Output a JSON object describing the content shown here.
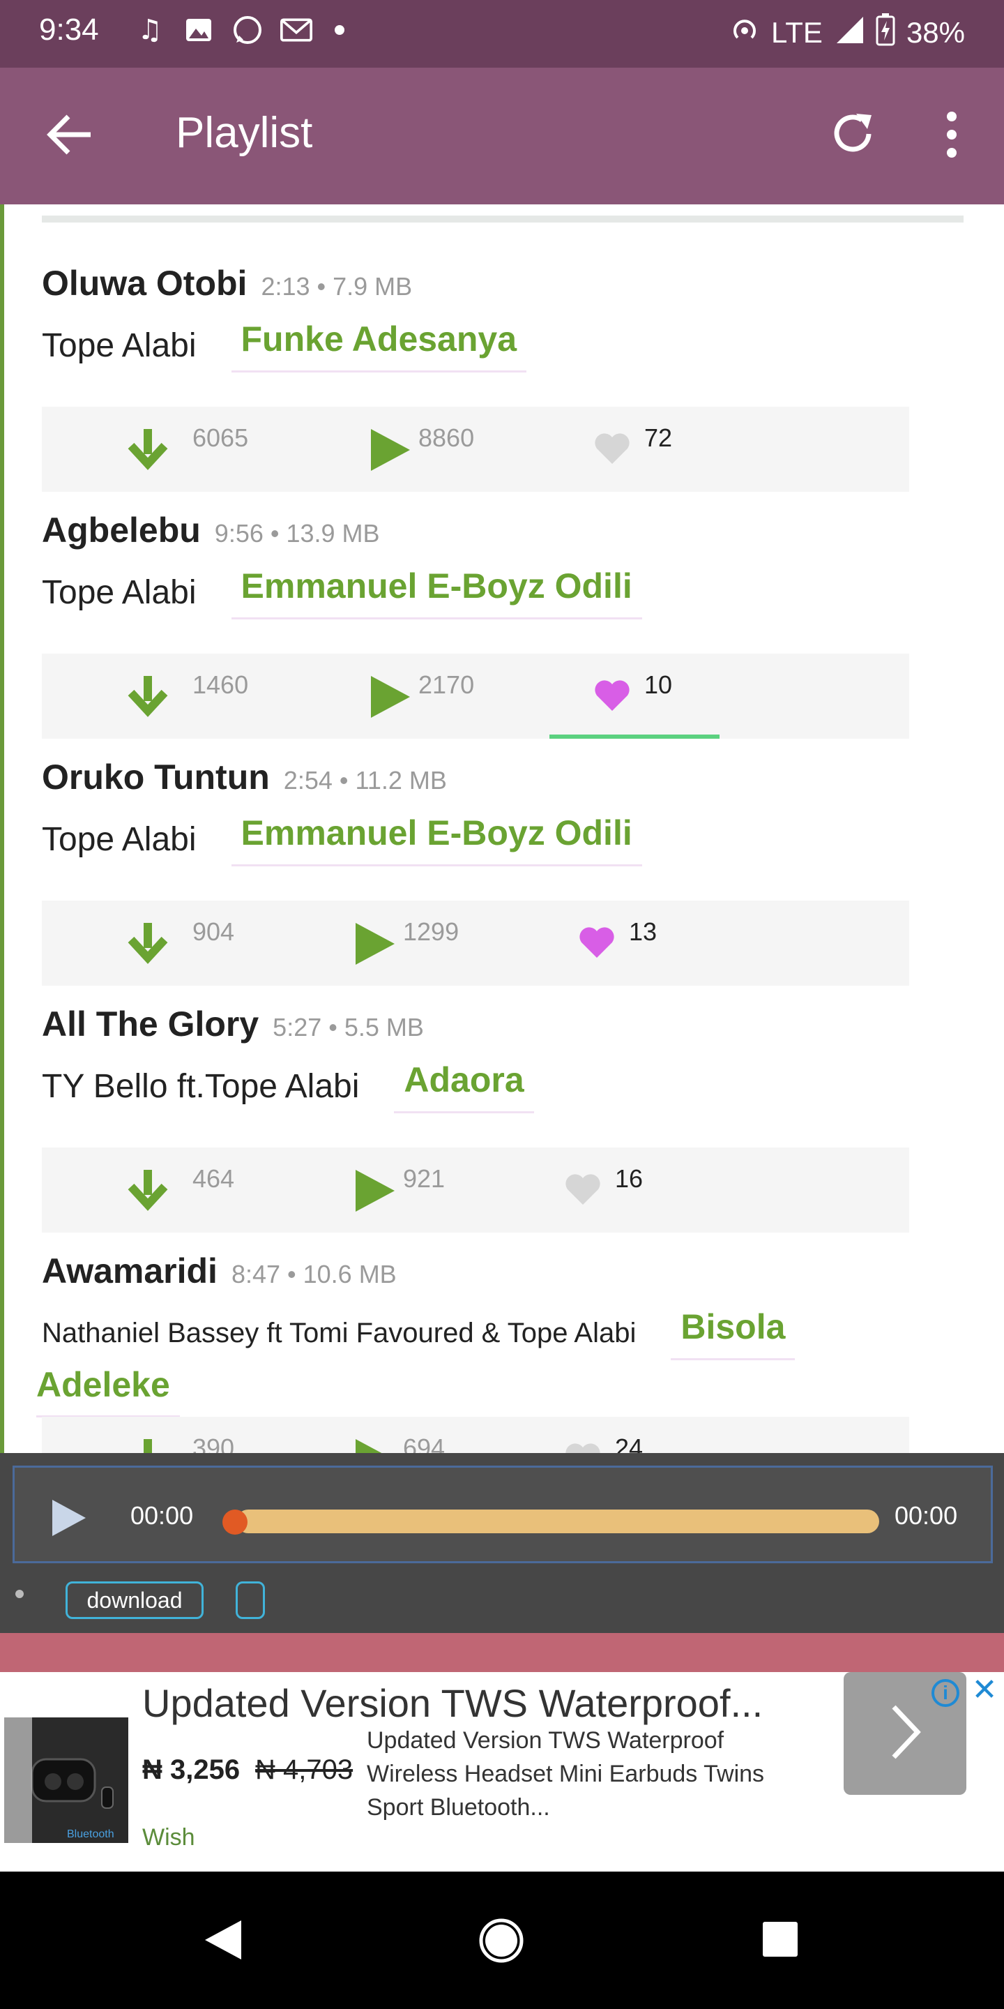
{
  "status_bar": {
    "time": "9:34",
    "left_icons": [
      "music-icon",
      "image-icon",
      "whatsapp-icon",
      "gmail-icon"
    ],
    "network": "LTE",
    "battery": "38%"
  },
  "app_bar": {
    "title": "Playlist",
    "back_icon": "arrow-left-icon",
    "refresh_icon": "refresh-icon",
    "more_icon": "more-vert-icon"
  },
  "tracks": [
    {
      "title": "Oluwa Otobi",
      "meta": "2:13 • 7.9 MB",
      "artist": "Tope Alabi",
      "arranger": "Funke Adesanya",
      "downloads": "6065",
      "plays": "8860",
      "likes": "72",
      "liked": false
    },
    {
      "title": "Agbelebu",
      "meta": "9:56 • 13.9 MB",
      "artist": "Tope Alabi",
      "arranger": "Emmanuel E-Boyz Odili",
      "downloads": "1460",
      "plays": "2170",
      "likes": "10",
      "liked": true
    },
    {
      "title": "Oruko Tuntun",
      "meta": "2:54 • 11.2 MB",
      "artist": "Tope Alabi",
      "arranger": "Emmanuel E-Boyz Odili",
      "downloads": "904",
      "plays": "1299",
      "likes": "13",
      "liked": true
    },
    {
      "title": "All The Glory",
      "meta": "5:27 • 5.5 MB",
      "artist": "TY Bello ft.Tope Alabi",
      "arranger": "Adaora",
      "downloads": "464",
      "plays": "921",
      "likes": "16",
      "liked": false
    },
    {
      "title": "Awamaridi",
      "meta": "8:47 • 10.6 MB",
      "artist": "Nathaniel Bassey ft Tomi Favoured & Tope Alabi",
      "arranger_line1": "Bisola",
      "arranger_line2": "Adeleke",
      "downloads": "390",
      "plays": "694",
      "likes": "24",
      "liked": false
    }
  ],
  "player": {
    "current_time": "00:00",
    "total_time": "00:00",
    "download_label": "download"
  },
  "ad": {
    "title": "Updated Version TWS Waterproof...",
    "price": "₦ 3,256",
    "old_price": "₦ 4,703",
    "description": "Updated Version TWS Waterproof Wireless Headset Mini Earbuds Twins Sport Bluetooth...",
    "brand": "Wish",
    "image_label": "Bluetooth",
    "info": "i",
    "close": "✕"
  },
  "colors": {
    "status_bar": "#6b3f5c",
    "app_bar": "#8a5677",
    "accent_green": "#6aa332",
    "like_pink": "#d85ee6",
    "progress": "#e9c07a"
  }
}
